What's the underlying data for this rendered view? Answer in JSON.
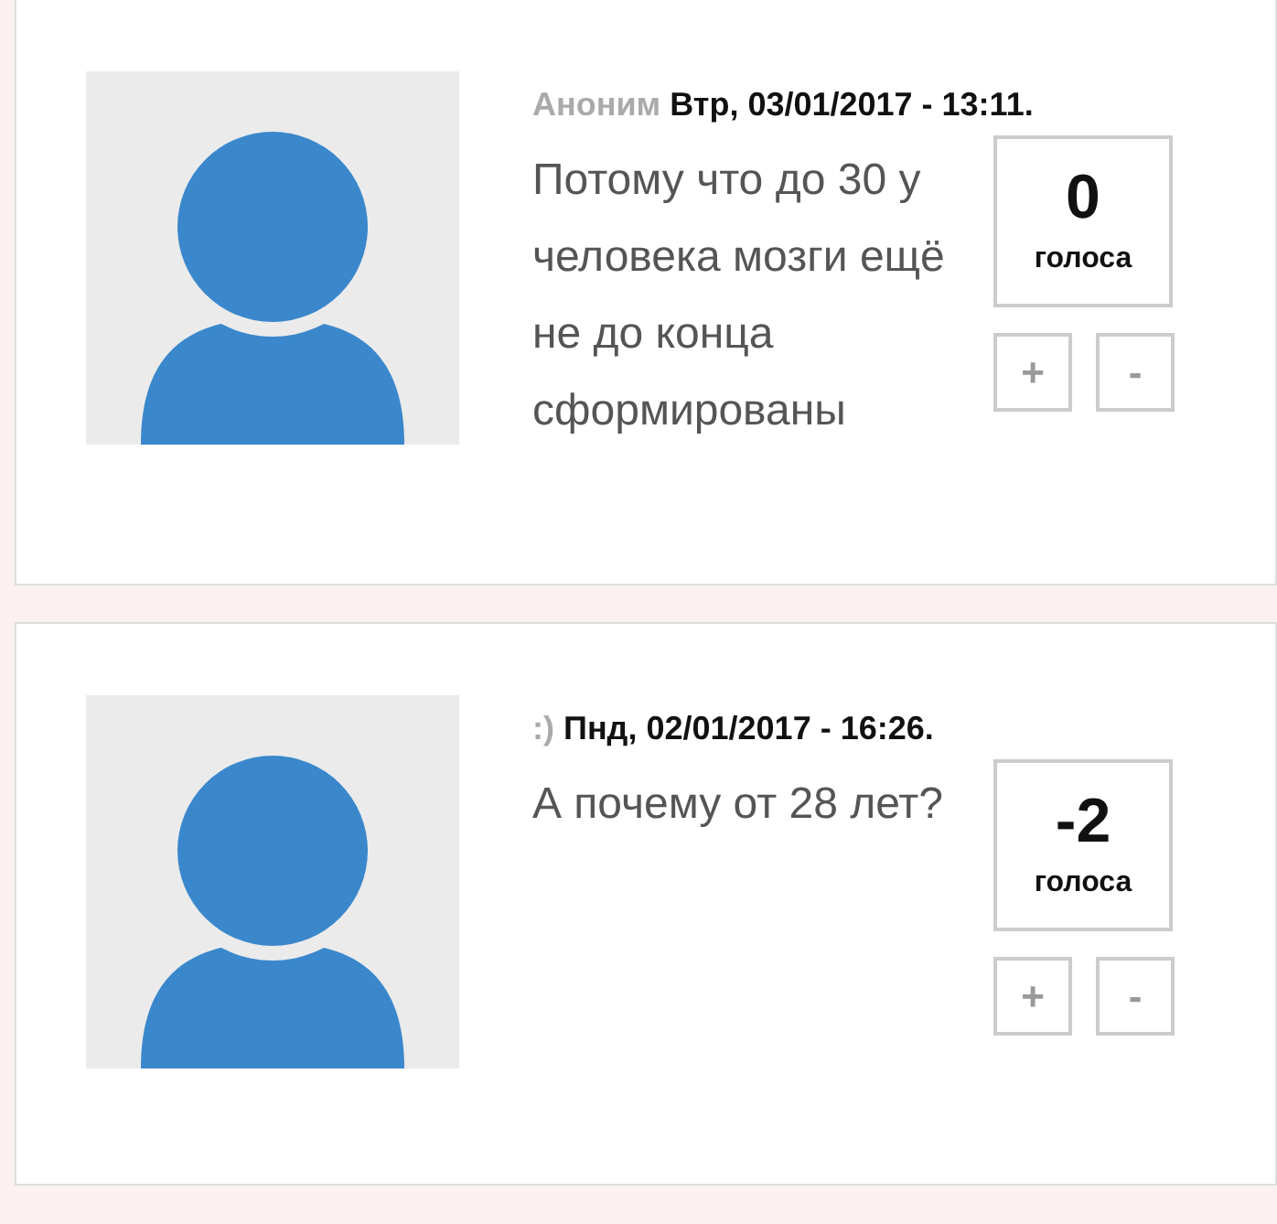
{
  "comments": [
    {
      "author": "Аноним",
      "date": "Втр, 03/01/2017 - 13:11.",
      "text": "Потому что до 30 у человека мозги ещё не до конца сформированы",
      "votes": "0",
      "votes_label": "голоса",
      "buttons": [
        "+",
        "-"
      ]
    },
    {
      "author": ":)",
      "date": "Пнд, 02/01/2017 - 16:26.",
      "text": "А почему от 28 лет?",
      "votes": "-2",
      "votes_label": "голоса",
      "buttons": [
        "+",
        "-"
      ]
    }
  ]
}
